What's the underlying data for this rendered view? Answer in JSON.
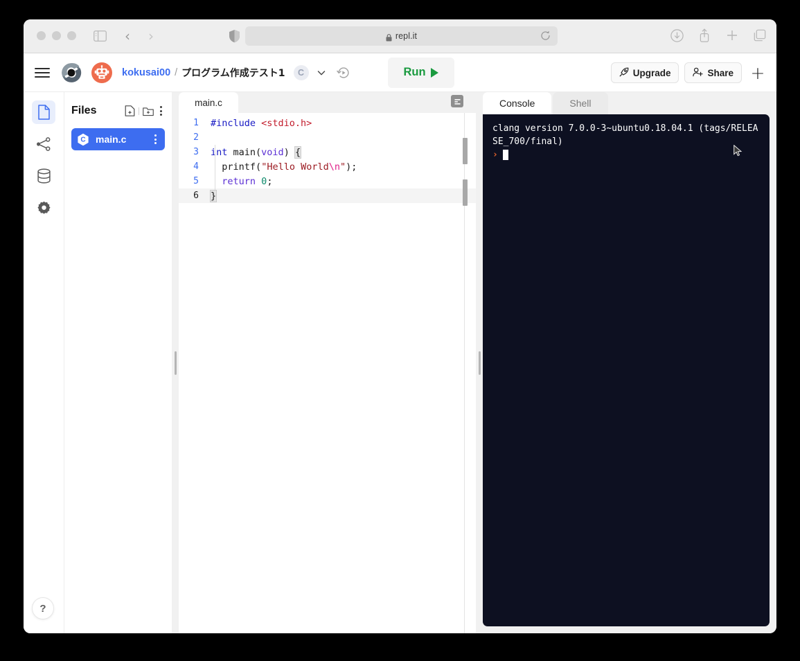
{
  "browser": {
    "url": "repl.it",
    "lock_icon": "lock-icon",
    "traffic_lights": [
      "close",
      "minimize",
      "zoom"
    ],
    "sidebar_toggle_icon": "sidebar-toggle-icon",
    "back_icon": "chevron-left-icon",
    "forward_icon": "chevron-right-icon",
    "shield_icon": "shield-icon",
    "reload_icon": "reload-icon",
    "right_icons": [
      "download-icon",
      "share-icon",
      "new-tab-icon",
      "tab-overview-icon"
    ]
  },
  "header": {
    "menu_icon": "hamburger-menu-icon",
    "logo_icon": "replit-logo-icon",
    "avatar_icon": "robot-avatar-icon",
    "username": "kokusai00",
    "separator": "/",
    "project_title": "プログラム作成テスト1",
    "language_badge": "C",
    "chevron_icon": "chevron-down-icon",
    "history_icon": "history-revert-icon",
    "run_label": "Run",
    "run_triangle": "play-triangle-icon",
    "upgrade_label": "Upgrade",
    "upgrade_icon": "rocket-icon",
    "share_label": "Share",
    "share_icon": "person-add-icon",
    "plus_label": "+"
  },
  "rail": {
    "items": [
      {
        "name": "files",
        "icon": "file-icon",
        "active": true
      },
      {
        "name": "version-control",
        "icon": "branch-icon",
        "active": false
      },
      {
        "name": "database",
        "icon": "database-icon",
        "active": false
      },
      {
        "name": "settings",
        "icon": "gear-icon",
        "active": false
      }
    ],
    "help_label": "?"
  },
  "files_panel": {
    "title": "Files",
    "new_file_icon": "new-file-icon",
    "new_folder_icon": "new-folder-icon",
    "menu_icon": "kebab-menu-icon",
    "items": [
      {
        "name": "main.c",
        "icon": "c-language-icon",
        "selected": true
      }
    ]
  },
  "editor": {
    "tab_label": "main.c",
    "format_icon": "format-code-icon",
    "active_line": 6,
    "lines": [
      {
        "num": "1",
        "tokens": [
          {
            "t": "#include ",
            "c": "tok-pre"
          },
          {
            "t": "<stdio.h>",
            "c": "tok-inc"
          }
        ]
      },
      {
        "num": "2",
        "tokens": []
      },
      {
        "num": "3",
        "tokens": [
          {
            "t": "int ",
            "c": "tok-kw"
          },
          {
            "t": "main",
            "c": "tok-fn"
          },
          {
            "t": "(",
            "c": "code-txt"
          },
          {
            "t": "void",
            "c": "tok-type"
          },
          {
            "t": ") ",
            "c": "code-txt"
          },
          {
            "t": "{",
            "c": "code-txt brace-match"
          }
        ]
      },
      {
        "num": "4",
        "tokens": [
          {
            "t": "  printf",
            "c": "tok-fn"
          },
          {
            "t": "(",
            "c": "code-txt"
          },
          {
            "t": "\"Hello World",
            "c": "tok-str"
          },
          {
            "t": "\\n",
            "c": "tok-esc"
          },
          {
            "t": "\"",
            "c": "tok-str"
          },
          {
            "t": ");",
            "c": "code-txt"
          }
        ]
      },
      {
        "num": "5",
        "tokens": [
          {
            "t": "  ",
            "c": "code-txt"
          },
          {
            "t": "return ",
            "c": "tok-type"
          },
          {
            "t": "0",
            "c": "tok-num"
          },
          {
            "t": ";",
            "c": "code-txt"
          }
        ]
      },
      {
        "num": "6",
        "tokens": [
          {
            "t": "}",
            "c": "code-txt brace-match"
          }
        ]
      }
    ]
  },
  "console": {
    "tabs": [
      {
        "label": "Console",
        "active": true
      },
      {
        "label": "Shell",
        "active": false
      }
    ],
    "output": "clang version 7.0.0-3~ubuntu0.18.04.1 (tags/RELEASE_700/final)",
    "prompt": "›",
    "cursor": "block-cursor"
  },
  "colors": {
    "accent_blue": "#3d6df0",
    "run_green": "#1a9a3f",
    "avatar_orange": "#ee6c4d",
    "terminal_bg": "#0d1021",
    "prompt_orange": "#e8622b"
  }
}
